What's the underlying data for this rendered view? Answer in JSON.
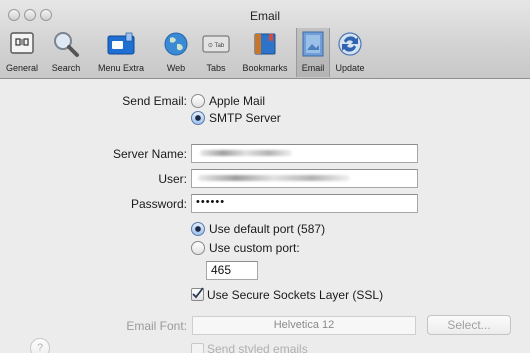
{
  "window": {
    "title": "Email"
  },
  "toolbar": {
    "items": [
      {
        "label": "General",
        "icon": "general-icon"
      },
      {
        "label": "Search",
        "icon": "search-icon"
      },
      {
        "label": "Menu Extra",
        "icon": "menu-extra-icon"
      },
      {
        "label": "Web",
        "icon": "web-icon"
      },
      {
        "label": "Tabs",
        "icon": "tabs-icon"
      },
      {
        "label": "Bookmarks",
        "icon": "bookmarks-icon"
      },
      {
        "label": "Email",
        "icon": "email-icon",
        "selected": true
      },
      {
        "label": "Update",
        "icon": "update-icon"
      }
    ],
    "tabs_icon_text": "⊙ Tab"
  },
  "form": {
    "send_email_label": "Send Email:",
    "option_apple_mail": "Apple Mail",
    "option_smtp": "SMTP Server",
    "send_method": "SMTP Server",
    "server_name_label": "Server Name:",
    "user_label": "User:",
    "password_label": "Password:",
    "password_value": "••••••",
    "default_port_label": "Use default port (587)",
    "custom_port_label": "Use custom port:",
    "port_mode": "default",
    "custom_port_value": "465",
    "ssl_label": "Use Secure Sockets Layer (SSL)",
    "ssl_checked": true,
    "email_font_label": "Email Font:",
    "email_font_value": "Helvetica 12",
    "select_button": "Select...",
    "styled_emails_label": "Send styled emails",
    "styled_emails_checked": false
  },
  "help": {
    "label": "?"
  },
  "colors": {
    "selection_blue": "#5b7aa8",
    "disabled_text": "#9a9a9a"
  }
}
